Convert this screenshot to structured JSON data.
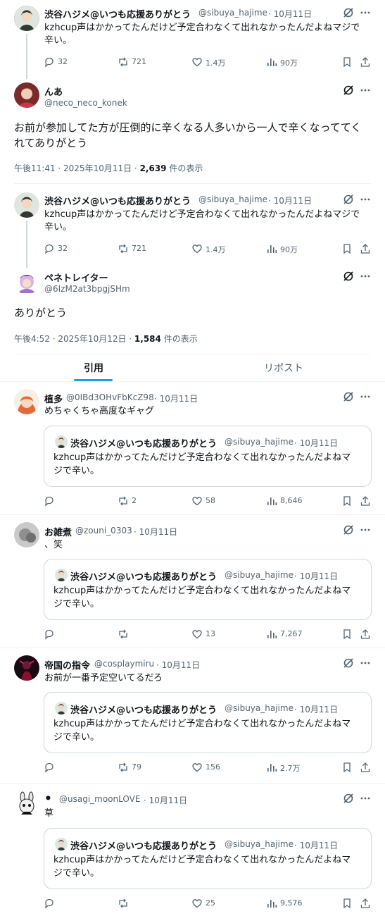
{
  "thread": {
    "quoted_tweet": {
      "author_name": "渋谷ハジメ@いつも応援ありがとう",
      "author_handle": "@sibuya_hajime",
      "date": "· 10月11日",
      "text_line1": "kzhcup声はかかってたんだけど予定合わなくて出れなかったんだよねマジで",
      "text_line2": "辛い。",
      "replies": "32",
      "reposts": "721",
      "likes": "1.4万",
      "views": "90万"
    },
    "reply1": {
      "author_name": "んあ",
      "author_handle": "@neco_neco_konek",
      "text_line1": "お前が参加してた方が圧倒的に辛くなる人多いから一人で辛くなっててく",
      "text_line2": "れてありがとう",
      "time": "午後11:41 · 2025年10月11日 · ",
      "view_count": "2,639",
      "view_suffix": " 件の表示"
    },
    "reply2": {
      "author_name": "ペネトレイター",
      "author_handle": "@6IzM2at3bpgjSHm",
      "text": "ありがとう",
      "time": "午後4:52 · 2025年10月12日 · ",
      "view_count": "1,584",
      "view_suffix": " 件の表示"
    }
  },
  "tabs": {
    "quotes": "引用",
    "reposts": "リポスト"
  },
  "quote_posts": [
    {
      "author_name": "植多",
      "author_handle": "@0IBd3OHvFbKcZ98",
      "date": "· 10月11日",
      "text": "めちゃくちゃ高度なギャグ",
      "reposts": "2",
      "likes": "58",
      "views": "8,646"
    },
    {
      "author_name": "お雑煮",
      "author_handle": "@zouni_0303",
      "date": "· 10月11日",
      "text": "、笑",
      "reposts": "",
      "likes": "13",
      "views": "7,267"
    },
    {
      "author_name": "帝国の指令",
      "author_handle": "@cosplaymiru",
      "date": "· 10月11日",
      "text": "お前が一番予定空いてるだろ",
      "reposts": "79",
      "likes": "156",
      "views": "2.7万"
    },
    {
      "author_name": "⚫",
      "author_handle": "@usagi_moonLOVE",
      "date": "· 10月11日",
      "text": "草",
      "reposts": "",
      "likes": "25",
      "views": "9,576"
    }
  ],
  "embedded_quote": {
    "author_name": "渋谷ハジメ@いつも応援ありがとう",
    "author_handle": "@sibuya_hajime",
    "date": "· 10月11日",
    "text_line1": "kzhcup声はかかってたんだけど予定合わなくて出れなかったんだよねマ",
    "text_line2": "ジで辛い。"
  },
  "colors": {
    "accent": "#1d9bf0",
    "text": "#0f1419",
    "muted": "#536471",
    "border": "#eff3f4"
  }
}
